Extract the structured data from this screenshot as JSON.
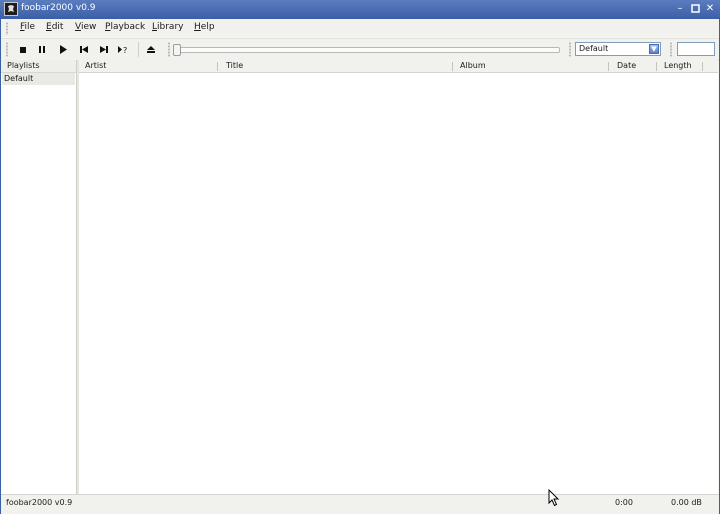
{
  "window": {
    "title": "foobar2000 v0.9",
    "controls": [
      "minimize-icon",
      "maximize-icon",
      "close-icon"
    ],
    "accent": "#3b5ea6"
  },
  "menu": [
    {
      "label": "File",
      "accel": "F",
      "rest": "ile"
    },
    {
      "label": "Edit",
      "accel": "E",
      "rest": "dit"
    },
    {
      "label": "View",
      "accel": "V",
      "rest": "iew"
    },
    {
      "label": "Playback",
      "accel": "P",
      "rest": "layback"
    },
    {
      "label": "Library",
      "accel": "L",
      "rest": "ibrary"
    },
    {
      "label": "Help",
      "accel": "H",
      "rest": "elp"
    }
  ],
  "toolbar": {
    "buttons": [
      "stop-icon",
      "pause-icon",
      "play-icon",
      "previous-icon",
      "next-icon",
      "random-icon",
      "open-icon"
    ],
    "seek_position": 0,
    "playlist_dropdown_value": "Default",
    "search_value": ""
  },
  "playlists": {
    "header": "Playlists",
    "items": [
      "Default"
    ]
  },
  "playlist_view": {
    "columns": [
      "Artist",
      "Title",
      "Album",
      "Date",
      "Length"
    ],
    "rows": []
  },
  "status": {
    "left": "foobar2000 v0.9",
    "time": "0:00",
    "volume": "0.00 dB"
  }
}
